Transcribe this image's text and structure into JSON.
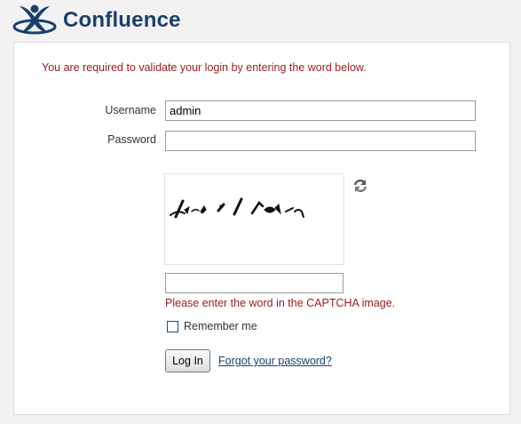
{
  "app": {
    "logo_text": "Confluence",
    "icon": "confluence-logo-icon",
    "brand_color": "#1a3f6b"
  },
  "login": {
    "warning": "You are required to validate your login by entering the word below.",
    "warning_color": "#9a1b1b",
    "username_label": "Username",
    "username_value": "admin",
    "password_label": "Password",
    "password_value": "",
    "captcha_refresh_icon": "refresh-icon",
    "captcha_value": "",
    "captcha_error": "Please enter the word in the CAPTCHA image.",
    "remember_label": "Remember me",
    "remember_checked": false,
    "login_button": "Log In",
    "forgot_link": "Forgot your password?"
  }
}
